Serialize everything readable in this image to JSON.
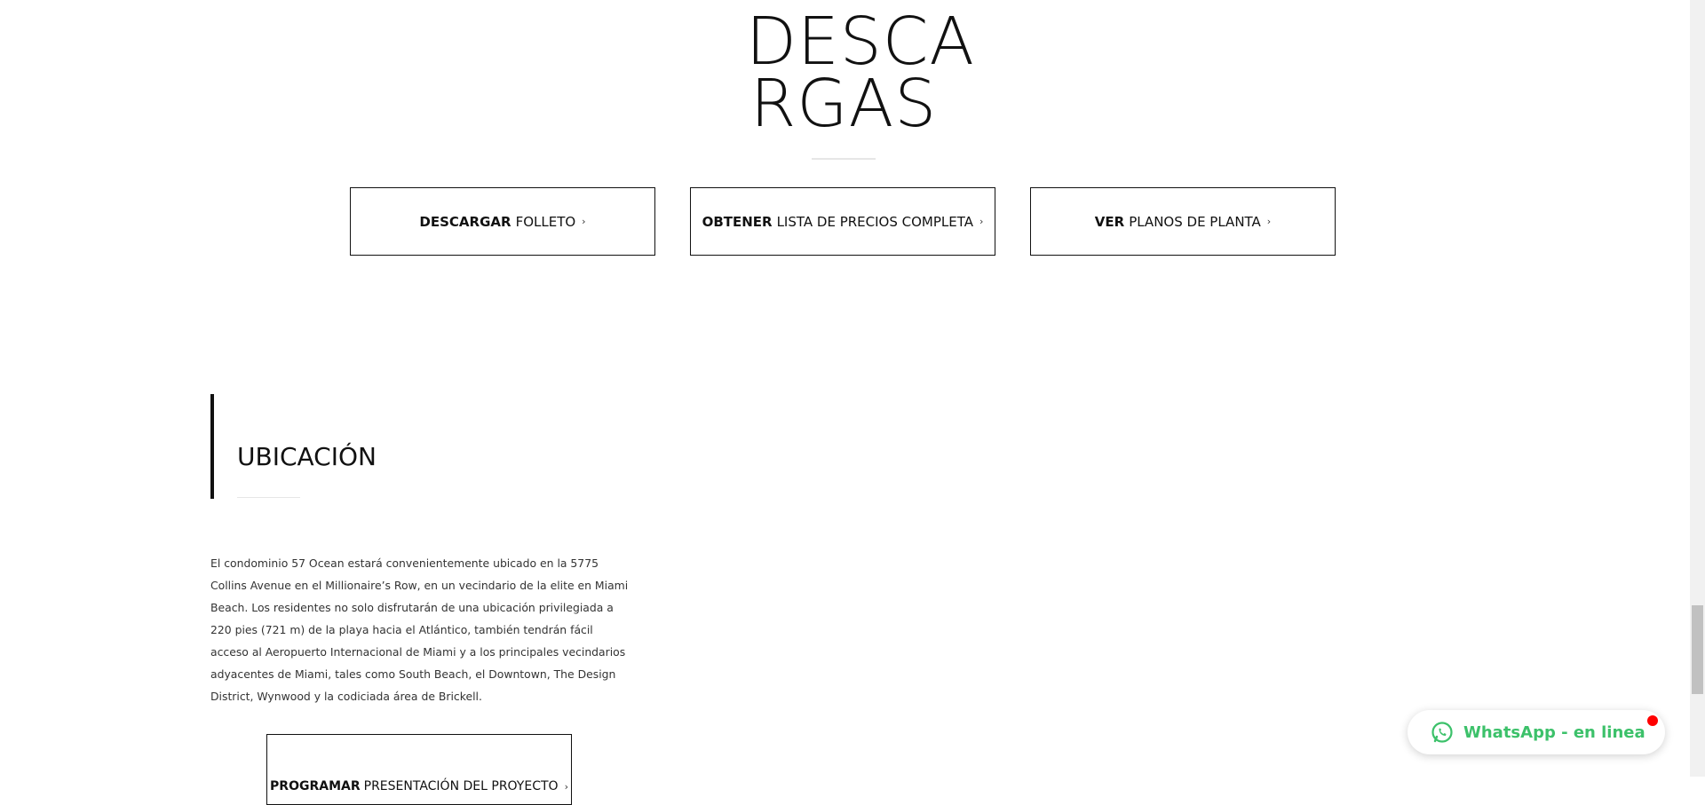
{
  "downloads": {
    "title_line1": "DESCA",
    "title_line2": "RGAS",
    "buttons": [
      {
        "bold": "DESCARGAR",
        "text": "FOLLETO",
        "chevron": "›"
      },
      {
        "bold": "OBTENER",
        "text": "LISTA DE PRECIOS COMPLETA",
        "chevron": "›"
      },
      {
        "bold": "VER",
        "text": "PLANOS DE PLANTA",
        "chevron": "›"
      }
    ]
  },
  "location": {
    "title": "UBICACIÓN",
    "paragraph": "El condominio 57 Ocean estará convenientemente ubicado en la 5775 Collins Avenue en el Millionaire’s Row, en un vecindario de la elite en Miami Beach. Los residentes no solo disfrutarán de una ubicación privilegiada a 220 pies (721 m) de la playa hacia el Atlántico, también tendrán fácil acceso al Aeropuerto Internacional de Miami y a los principales vecindarios adyacentes de Miami, tales como South Beach, el Downtown, The Design District, Wynwood y la codiciada área de Brickell.",
    "cta": {
      "bold": "PROGRAMAR",
      "text": "PRESENTACIÓN DEL PROYECTO",
      "chevron": "›"
    }
  },
  "whatsapp": {
    "label": "WhatsApp - en linea",
    "icon": "whatsapp-icon",
    "color": "#3cc16a",
    "dot_color": "#ff0000"
  }
}
